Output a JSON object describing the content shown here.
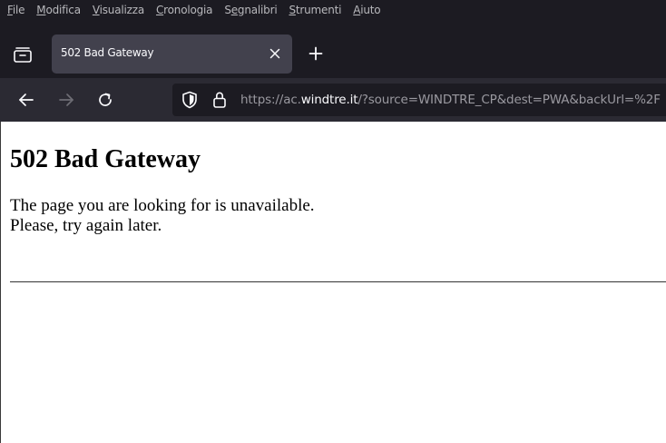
{
  "menubar": {
    "items": [
      {
        "mnemonic": "F",
        "rest": "ile"
      },
      {
        "mnemonic": "M",
        "rest": "odifica"
      },
      {
        "mnemonic": "V",
        "rest": "isualizza"
      },
      {
        "mnemonic": "C",
        "rest": "ronologia"
      },
      {
        "pre": "S",
        "mnemonic": "e",
        "rest": "gnalibri"
      },
      {
        "mnemonic": "S",
        "rest": "trumenti"
      },
      {
        "mnemonic": "A",
        "rest": "iuto"
      }
    ]
  },
  "tabs": {
    "active_title": "502 Bad Gateway"
  },
  "urlbar": {
    "prefix": "https://ac.",
    "host": "windtre.it",
    "path": "/?source=WINDTRE_CP&dest=PWA&backUrl=%2F"
  },
  "page": {
    "heading": "502 Bad Gateway",
    "line1": "The page you are looking for is unavailable.",
    "line2": "Please, try again later."
  },
  "icons": {
    "list_tabs": "list-all-tabs-icon",
    "close_tab": "close-icon",
    "new_tab": "plus-icon",
    "back": "back-arrow-icon",
    "forward": "forward-arrow-icon",
    "reload": "reload-icon",
    "tracking_protection": "shield-icon",
    "security": "lock-icon"
  }
}
